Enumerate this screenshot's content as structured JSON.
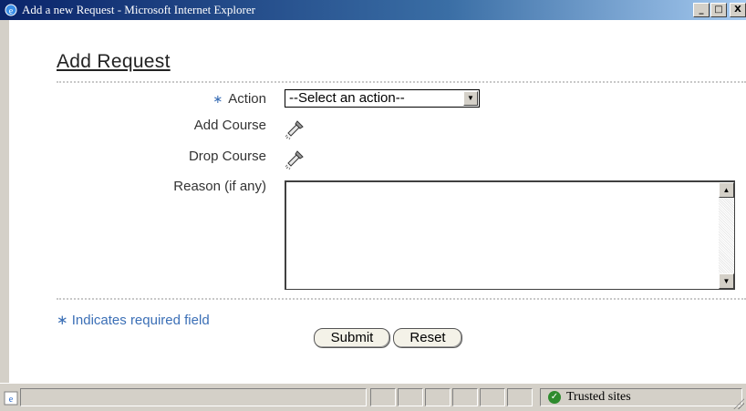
{
  "window": {
    "title": "Add a new Request - Microsoft Internet Explorer",
    "minimize": "_",
    "maximize": "□",
    "close": "X"
  },
  "form": {
    "title": "Add Request",
    "required_marker": "∗",
    "action_label": "Action",
    "action_select_value": "--Select an action--",
    "add_course_label": "Add Course",
    "drop_course_label": "Drop Course",
    "reason_label": "Reason (if any)",
    "reason_value": "",
    "required_note": "∗ Indicates required field",
    "submit_label": "Submit",
    "reset_label": "Reset"
  },
  "statusbar": {
    "zone": "Trusted sites"
  },
  "icons": {
    "lookup": "flashlight-icon",
    "browser": "ie-icon",
    "zone": "trusted-check-icon"
  },
  "colors": {
    "accent": "#3b6fb6",
    "title_bar": "#0a246a",
    "zone_ok": "#2e8b2e"
  }
}
